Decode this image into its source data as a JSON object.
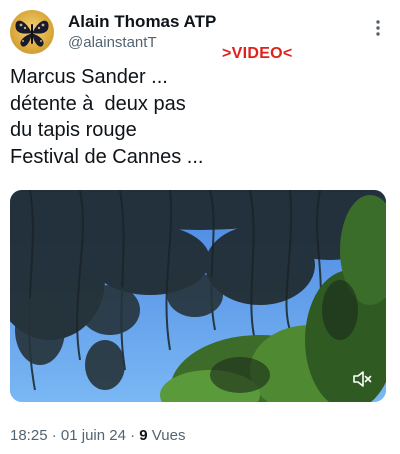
{
  "author": {
    "display_name": "Alain Thomas ATP",
    "handle": "@alainstantT",
    "avatar_icon": "butterfly-icon"
  },
  "overlay_tag": ">VIDEO<",
  "tweet": {
    "lines": [
      "Marcus Sander ...",
      "détente à  deux pas",
      "du tapis rouge",
      "Festival de Cannes ..."
    ]
  },
  "media": {
    "type": "video",
    "mute_icon": "speaker-muted-icon"
  },
  "meta": {
    "time": "18:25",
    "separator": " · ",
    "date": "01 juin 24",
    "views_count": "9",
    "views_label": " Vues"
  },
  "colors": {
    "text": "#0f1419",
    "secondary": "#536471",
    "video_tag": "#e0201a",
    "sky": "#5c9ef0"
  }
}
